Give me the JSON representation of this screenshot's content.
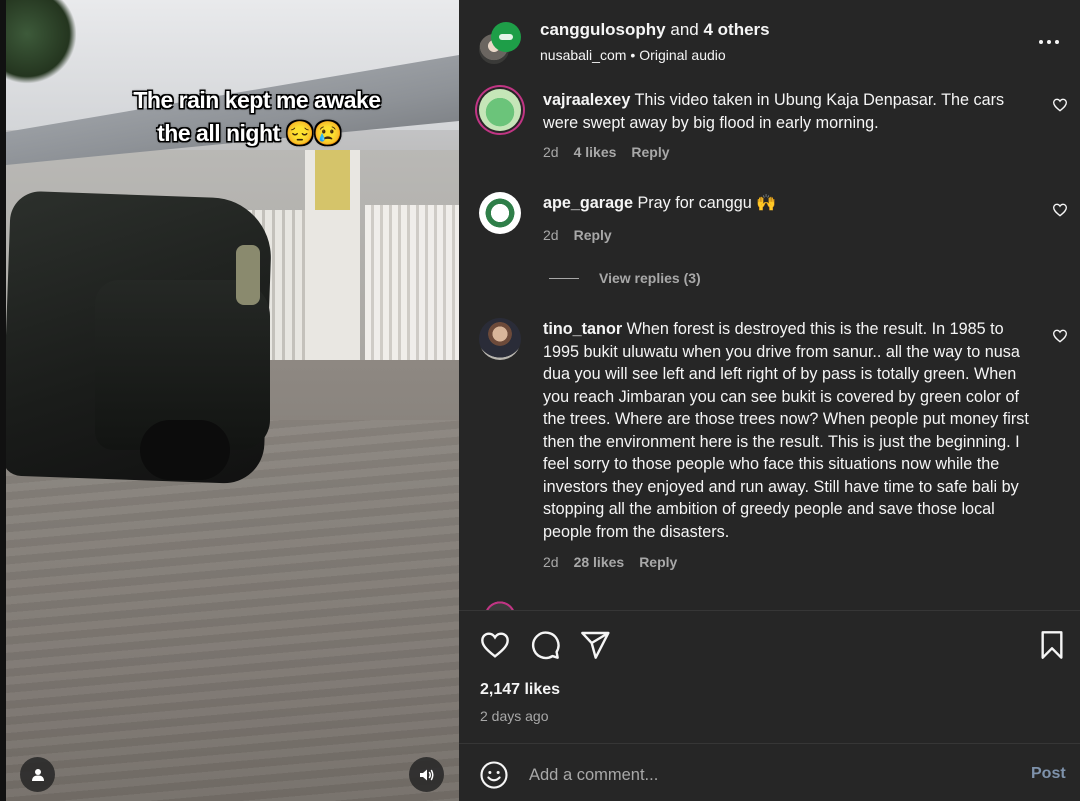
{
  "video": {
    "caption_line1": "The rain kept me awake",
    "caption_line2": "the all night 😔😢"
  },
  "header": {
    "author": "canggulosophy",
    "and_text": "and",
    "others": "4 others",
    "account": "nusabali_com",
    "separator": "•",
    "audio": "Original audio"
  },
  "comments": [
    {
      "username": "vajraalexey",
      "text": "This video taken in Ubung Kaja Denpasar. The cars were swept away by big flood in early morning.",
      "time": "2d",
      "likes": "4 likes",
      "reply": "Reply"
    },
    {
      "username": "ape_garage",
      "text": "Pray for canggu 🙌",
      "time": "2d",
      "reply": "Reply",
      "view_replies": "View replies (3)"
    },
    {
      "username": "tino_tanor",
      "text": "When forest is destroyed this is the result. In 1985 to 1995 bukit uluwatu when you drive from sanur.. all the way to nusa dua you will see left and left right of by pass is totally green. When you reach Jimbaran you can see bukit is covered by green color of the trees. Where are those trees now? When people put money first then the environment here is the result. This is just the beginning. I feel sorry to those people who face this situations now while the investors they enjoyed and run away. Still have time to safe bali by stopping all the ambition of greedy people and save those local people from the disasters.",
      "time": "2d",
      "likes": "28 likes",
      "reply": "Reply"
    }
  ],
  "partial_comment": "",
  "post": {
    "likes": "2,147 likes",
    "ago": "2 days ago"
  },
  "composer": {
    "placeholder": "Add a comment...",
    "post_label": "Post"
  },
  "icons": [
    "user-icon",
    "volume-icon",
    "more-icon",
    "heart-icon",
    "comment-icon",
    "share-icon",
    "bookmark-icon",
    "emoji-icon"
  ]
}
